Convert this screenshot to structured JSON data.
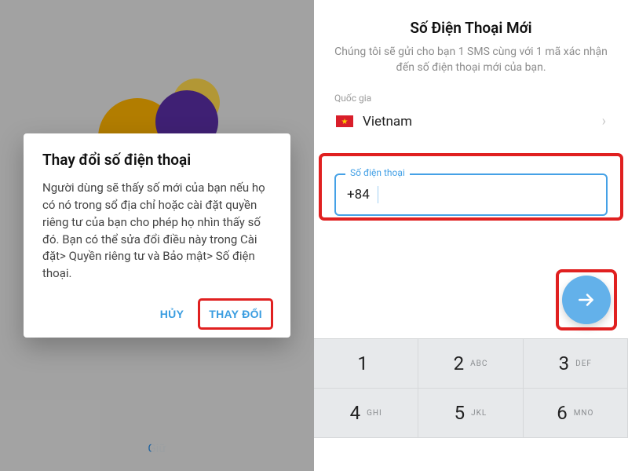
{
  "left": {
    "dialog": {
      "title": "Thay đổi số điện thoại",
      "body": "Người dùng sẽ thấy số mới của bạn nếu họ có nó trong sổ địa chỉ hoặc cài đặt quyền riêng tư của bạn cho phép họ nhìn thấy số đó.  Bạn có thể sửa đổi điều này trong Cài đặt> Quyền riêng tư và Bảo mật> Số điện thoại.",
      "cancel": "HỦY",
      "confirm": "THAY ĐỔI"
    },
    "bottom_hint": "Giữ"
  },
  "right": {
    "title": "Số Điện Thoại Mới",
    "subtitle": "Chúng tôi sẽ gửi cho bạn 1 SMS cùng với 1 mã xác nhận đến số điện thoại mới của bạn.",
    "country_label": "Quốc gia",
    "country_name": "Vietnam",
    "phone_label": "Số điện thoại",
    "phone_prefix": "+84",
    "phone_value": "",
    "keypad": [
      {
        "n": "1",
        "l": ""
      },
      {
        "n": "2",
        "l": "ABC"
      },
      {
        "n": "3",
        "l": "DEF"
      },
      {
        "n": "4",
        "l": "GHI"
      },
      {
        "n": "5",
        "l": "JKL"
      },
      {
        "n": "6",
        "l": "MNO"
      }
    ]
  },
  "icons": {
    "chevron_right": "›",
    "arrow_right": "arrow-right-icon",
    "flag_vn": "flag-vietnam-icon"
  },
  "colors": {
    "accent": "#45a1e6",
    "highlight": "#e02020",
    "fab": "#63b1ea"
  }
}
